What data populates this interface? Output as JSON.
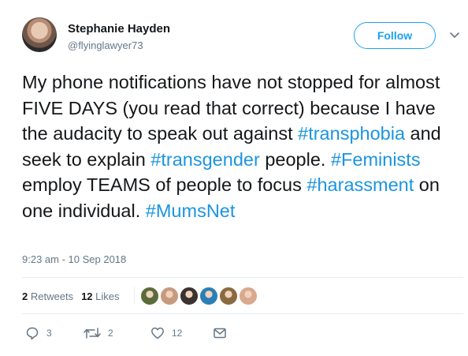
{
  "author": {
    "name": "Stephanie Hayden",
    "handle": "@flyinglawyer73"
  },
  "follow_button": {
    "label": "Follow"
  },
  "tweet": {
    "segments": [
      {
        "text": "My phone notifications have not stopped for almost FIVE DAYS (you read that correct) because I have the audacity to speak out against ",
        "hashtag": false
      },
      {
        "text": "#transphobia",
        "hashtag": true
      },
      {
        "text": " and seek to explain ",
        "hashtag": false
      },
      {
        "text": "#transgender",
        "hashtag": true
      },
      {
        "text": " people. ",
        "hashtag": false
      },
      {
        "text": "#Feminists",
        "hashtag": true
      },
      {
        "text": " employ TEAMS of people to focus ",
        "hashtag": false
      },
      {
        "text": "#harassment",
        "hashtag": true
      },
      {
        "text": " on one individual. ",
        "hashtag": false
      },
      {
        "text": "#MumsNet",
        "hashtag": true
      }
    ],
    "timestamp": "9:23 am - 10 Sep 2018"
  },
  "stats": {
    "retweets_count": "2",
    "retweets_label": "Retweets",
    "likes_count": "12",
    "likes_label": "Likes"
  },
  "likers": [
    {
      "color": "#5b6b3a"
    },
    {
      "color": "#c79a7e"
    },
    {
      "color": "#3a3330"
    },
    {
      "color": "#2a7fb8"
    },
    {
      "color": "#8a6a3f"
    },
    {
      "color": "#d9a98e"
    }
  ],
  "actions": {
    "reply_count": "3",
    "retweet_count": "2",
    "like_count": "12"
  },
  "colors": {
    "accent": "#1da1f2",
    "hashtag": "#1b95e0",
    "muted": "#657786"
  }
}
